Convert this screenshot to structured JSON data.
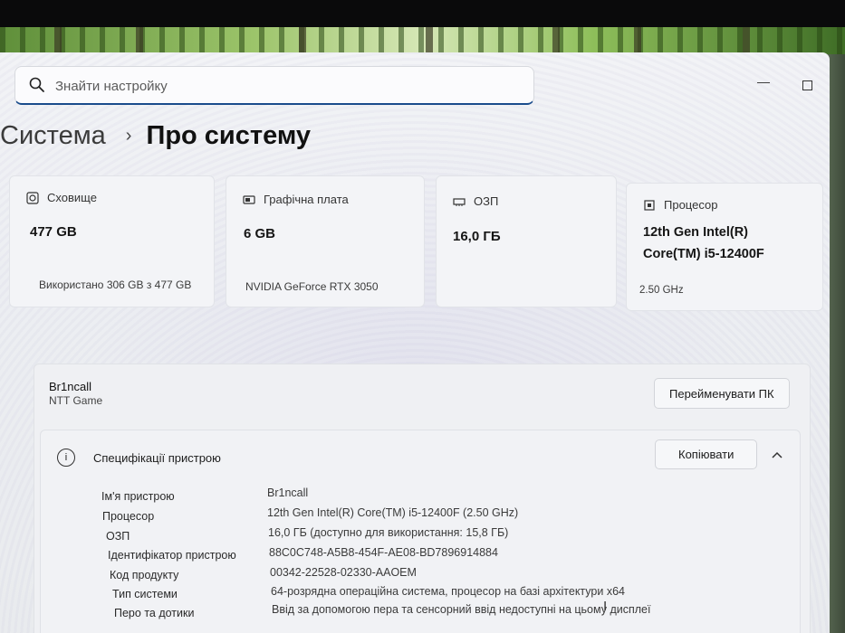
{
  "search": {
    "placeholder": "Знайти настройку"
  },
  "breadcrumb": {
    "parent": "Система",
    "separator": "›",
    "current": "Про систему"
  },
  "cards": [
    {
      "title": "Сховище",
      "value": "477 GB",
      "sub": "Використано 306 GB з 477 GB",
      "icon": "storage-icon"
    },
    {
      "title": "Графічна плата",
      "value": "6 GB",
      "sub": "NVIDIA GeForce RTX 3050",
      "icon": "gpu-icon"
    },
    {
      "title": "ОЗП",
      "value": "16,0 ГБ",
      "sub": "",
      "icon": "ram-icon"
    },
    {
      "title": "Процесор",
      "value": "12th Gen Intel(R) Core(TM) i5-12400F",
      "sub": "2.50 GHz",
      "icon": "cpu-icon"
    }
  ],
  "device": {
    "name": "Br1ncall",
    "model": "NTT Game",
    "rename_label": "Перейменувати ПК"
  },
  "specs": {
    "title": "Специфікації пристрою",
    "copy_label": "Копіювати",
    "collapse_icon": "chevron-up-icon",
    "rows": [
      {
        "label": "Ім'я пристрою",
        "value": "Br1ncall"
      },
      {
        "label": "Процесор",
        "value": "12th Gen Intel(R) Core(TM) i5-12400F (2.50 GHz)"
      },
      {
        "label": "ОЗП",
        "value": "16,0 ГБ (доступно для використання: 15,8 ГБ)"
      },
      {
        "label": "Ідентифікатор пристрою",
        "value": "88C0C748-A5B8-454F-AE08-BD7896914884"
      },
      {
        "label": "Код продукту",
        "value": "00342-22528-02330-AAOEM"
      },
      {
        "label": "Тип системи",
        "value": "64-розрядна операційна система, процесор на базі архітектури x64"
      },
      {
        "label": "Перо та дотики",
        "value": "Ввід за допомогою пера та сенсорний ввід недоступні на цьому дисплеї"
      }
    ]
  },
  "colors": {
    "accent": "#1a4c8c",
    "window_bg": "#eceef2",
    "card_bg": "#f3f4f7"
  }
}
